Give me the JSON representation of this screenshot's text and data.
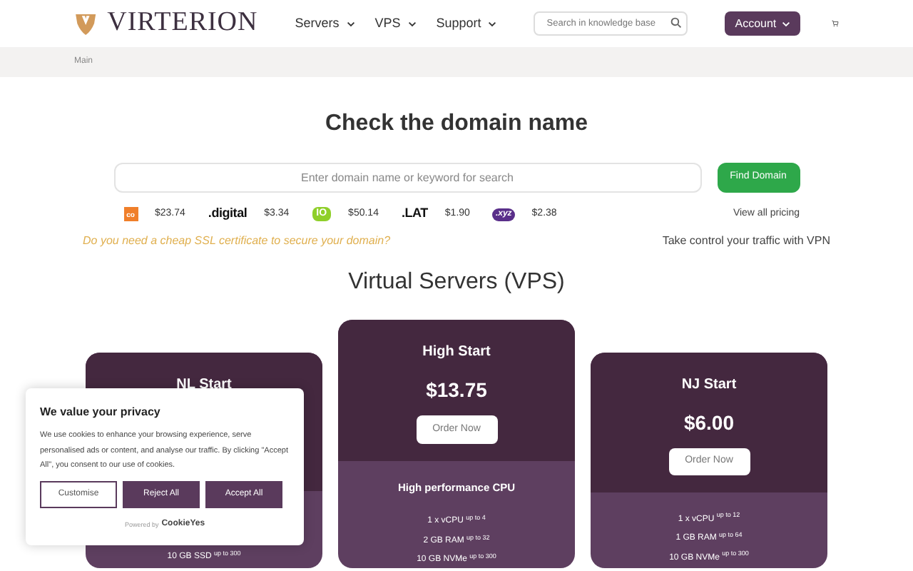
{
  "header": {
    "brand": "VIRTERION",
    "nav": [
      {
        "label": "Servers"
      },
      {
        "label": "VPS"
      },
      {
        "label": "Support"
      }
    ],
    "search": {
      "placeholder": "Search in knowledge base"
    },
    "account": "Account"
  },
  "breadcrumb": "Main",
  "domain": {
    "title": "Check the domain name",
    "search": {
      "placeholder": "Enter domain name or keyword for search"
    },
    "button": "Find Domain",
    "tlds": [
      {
        "kind": "orange",
        "logo": "co",
        "price": "$23.74"
      },
      {
        "kind": "plain",
        "logo": ".digital",
        "price": "$3.34"
      },
      {
        "kind": "green",
        "logo": "IO",
        "price": "$50.14"
      },
      {
        "kind": "plain",
        "logo": ".LAT",
        "price": "$1.90"
      },
      {
        "kind": "purple",
        "logo": ".xyz",
        "price": "$2.38"
      }
    ],
    "view_all": "View all pricing",
    "ssl_link": "Do you need a cheap SSL certificate to secure your domain?",
    "vpn_link": "Take control your traffic with VPN"
  },
  "vps": {
    "title": "Virtual Servers (VPS)",
    "plans": [
      {
        "name": "NL Start",
        "featured": false,
        "features": [
          "10 GB SSD $^{up to 300}$"
        ]
      },
      {
        "name": "High Start",
        "featured": true,
        "price": "$13.75",
        "button": "Order Now",
        "subtitle": "High performance CPU",
        "features": [
          "1 x vCPU $^{up to 4}$",
          "2 GB RAM $^{up to 32}$",
          "10 GB NVMe $^{up to 300}$"
        ]
      },
      {
        "name": "NJ Start",
        "featured": false,
        "price": "$6.00",
        "button": "Order Now",
        "features": [
          "1 x vCPU $^{up to 12}$",
          "1 GB RAM $^{up to 64}$",
          "10 GB NVMe $^{up to 300}$"
        ]
      }
    ]
  },
  "cookie_banner": {
    "title": "We value your privacy",
    "text": "We use cookies to enhance your browsing experience, serve personalised ads or content, and analyse our traffic. By clicking \"Accept All\", you consent to our use of cookies.",
    "buttons": [
      {
        "label": "Customise",
        "kind": "outline"
      },
      {
        "label": "Reject All",
        "kind": "filled"
      },
      {
        "label": "Accept All",
        "kind": "filled"
      }
    ],
    "powered_by": "Powered by",
    "brand": "CookieYes"
  }
}
